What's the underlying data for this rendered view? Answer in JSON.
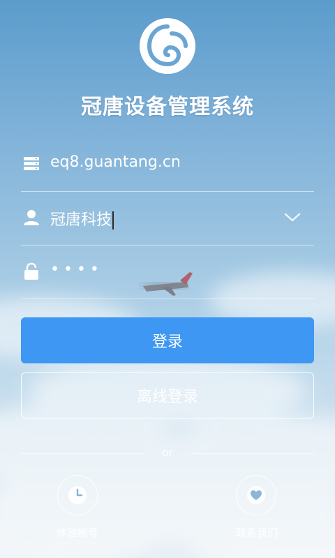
{
  "app": {
    "title": "冠唐设备管理系统"
  },
  "form": {
    "server_value": "eq8.guantang.cn",
    "username_value": "冠唐科技",
    "password_masked": "••••"
  },
  "buttons": {
    "login_label": "登录",
    "offline_login_label": "离线登录"
  },
  "divider": {
    "or_text": "or"
  },
  "quick_actions": [
    {
      "label": "体验帐号",
      "icon": "clock-icon"
    },
    {
      "label": "联系我们",
      "icon": "heart-icon"
    }
  ],
  "colors": {
    "primary_button": "#3d97f3",
    "text": "#ffffff"
  },
  "icons": {
    "server": "server-icon",
    "user": "user-icon",
    "lock": "lock-icon",
    "dropdown": "chevron-down-icon",
    "logo": "app-logo"
  }
}
